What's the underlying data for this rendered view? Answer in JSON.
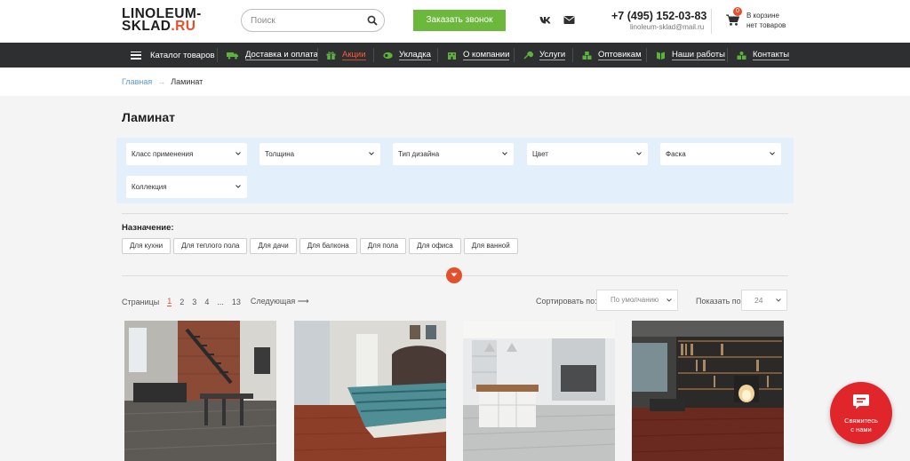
{
  "header": {
    "logo_line1": "LINOLEUM-",
    "logo_line2": "SKLAD",
    "logo_suffix": ".RU",
    "search_placeholder": "Поиск",
    "callback_button": "Заказать звонок",
    "phone": "+7 (495) 152-03-83",
    "email": "linoleum-sklad@mail.ru",
    "cart_count": "0",
    "cart_line1": "В корзине",
    "cart_line2": "нет товаров"
  },
  "nav": {
    "items": [
      {
        "label": "Каталог товаров",
        "icon": "menu-icon"
      },
      {
        "label": "Доставка и оплата",
        "icon": "truck-icon"
      },
      {
        "label": "Акции",
        "icon": "gift-icon",
        "highlight": true
      },
      {
        "label": "Укладка",
        "icon": "roll-icon"
      },
      {
        "label": "О компании",
        "icon": "building-icon"
      },
      {
        "label": "Услуги",
        "icon": "wrench-icon"
      },
      {
        "label": "Оптовикам",
        "icon": "boxes-icon"
      },
      {
        "label": "Наши работы",
        "icon": "book-icon"
      },
      {
        "label": "Контакты",
        "icon": "contacts-icon"
      }
    ]
  },
  "breadcrumb": {
    "home": "Главная",
    "separator": "→",
    "current": "Ламинат"
  },
  "page_title": "Ламинат",
  "filters": [
    "Класс применения",
    "Толщина",
    "Тип дизайна",
    "Цвет",
    "Фаска",
    "Коллекция"
  ],
  "purpose": {
    "label": "Назначение:",
    "tags": [
      "Для кухни",
      "Для теплого пола",
      "Для дачи",
      "Для балкона",
      "Для пола",
      "Для офиса",
      "Для ванной"
    ]
  },
  "pagination": {
    "label": "Страницы",
    "pages": [
      "1",
      "2",
      "3",
      "4",
      "...",
      "13"
    ],
    "current": "1",
    "next": "Следующая ⟶"
  },
  "sorting": {
    "sort_label": "Сортировать по:",
    "sort_value": "По умолчанию",
    "show_label": "Показать по:",
    "show_value": "24"
  },
  "products": [
    {
      "scene": "loft-living-room-with-staircase"
    },
    {
      "scene": "bedroom-with-red-floor"
    },
    {
      "scene": "white-kitchen-with-island"
    },
    {
      "scene": "library-with-fireplace"
    }
  ],
  "chat": {
    "label": "Свяжитесь\nс нами",
    "color": "#e1262b"
  },
  "colors": {
    "accent": "#e5502c",
    "green": "#6cb83d",
    "nav_bg": "#2d2f31",
    "filter_bg": "#e3f0fb"
  }
}
